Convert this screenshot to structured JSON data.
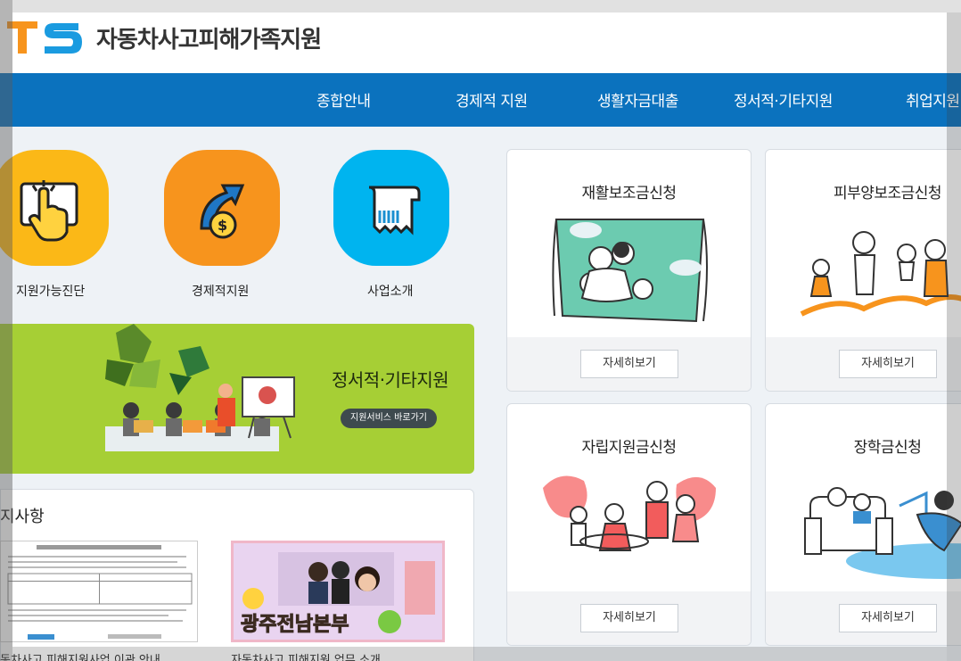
{
  "header": {
    "logo_text": "TS",
    "site_title": "자동차사고피해가족지원"
  },
  "nav": {
    "items": [
      "종합안내",
      "경제적 지원",
      "생활자금대출",
      "정서적·기타지원",
      "취업지원"
    ]
  },
  "quick_menu": [
    {
      "label": "지원가능진단",
      "icon": "touch-hand-icon",
      "color": "#fbb817"
    },
    {
      "label": "경제적지원",
      "icon": "coin-arrow-icon",
      "color": "#f7941d"
    },
    {
      "label": "사업소개",
      "icon": "receipt-icon",
      "color": "#00b4ef"
    }
  ],
  "banner": {
    "title": "정서적·기타지원",
    "button_label": "지원서비스 바로가기",
    "color": "#a6cf35"
  },
  "notice": {
    "title": "지사항",
    "items": [
      {
        "caption": "동차사고 피해지원사업 이관 안내"
      },
      {
        "caption": "자동차사고 피해지원 업무 소개",
        "image_text": "광주전남본부"
      }
    ]
  },
  "cards": [
    {
      "title": "재활보조금신청",
      "button_label": "자세히보기"
    },
    {
      "title": "피부양보조금신청",
      "button_label": "자세히보기"
    },
    {
      "title": "자립지원금신청",
      "button_label": "자세히보기"
    },
    {
      "title": "장학금신청",
      "button_label": "자세히보기"
    }
  ],
  "colors": {
    "nav": "#0b72be",
    "accent_orange": "#f28c1b",
    "accent_blue": "#00a0e9"
  }
}
